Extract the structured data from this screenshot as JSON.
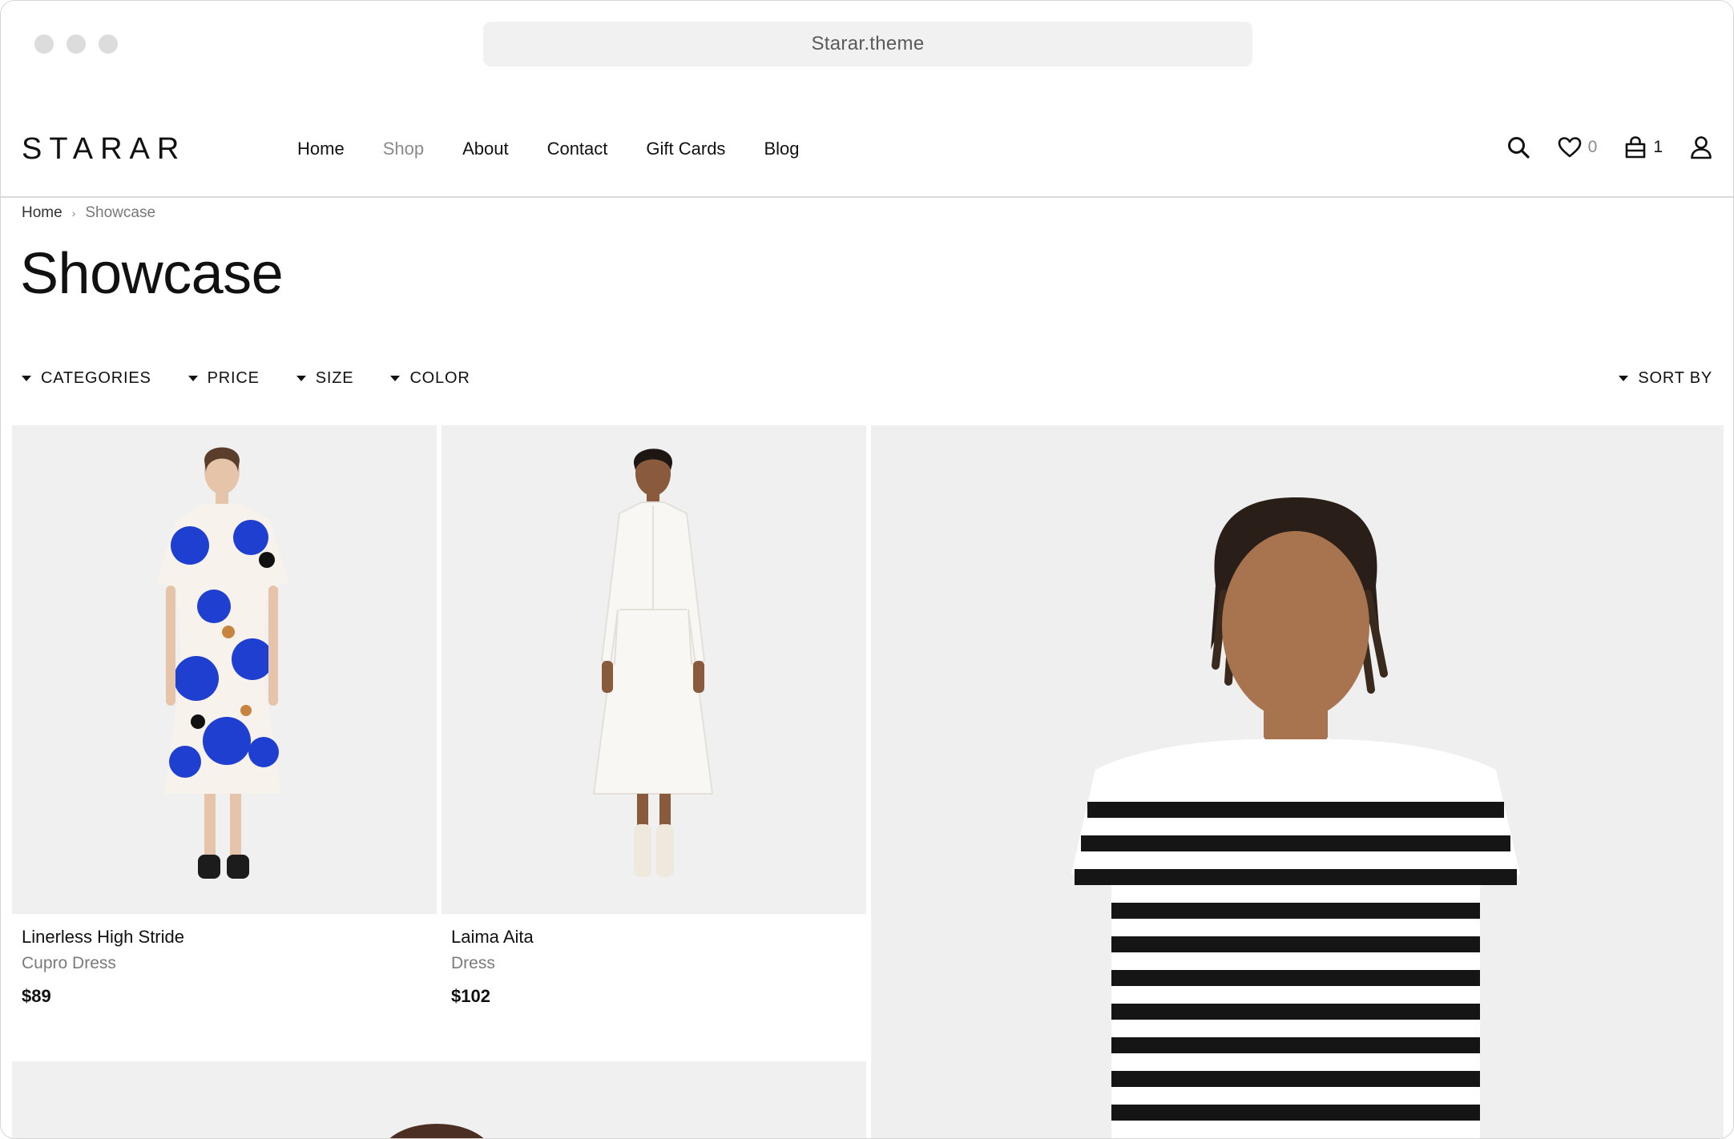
{
  "browser": {
    "url": "Starar.theme"
  },
  "header": {
    "logo": "STARAR",
    "nav": [
      {
        "label": "Home",
        "active": false
      },
      {
        "label": "Shop",
        "active": true
      },
      {
        "label": "About",
        "active": false
      },
      {
        "label": "Contact",
        "active": false
      },
      {
        "label": "Gift Cards",
        "active": false
      },
      {
        "label": "Blog",
        "active": false
      }
    ],
    "icons": [
      "search-icon",
      "heart-icon",
      "bag-icon",
      "user-icon"
    ],
    "wishlist_count": "0",
    "cart_count": "1"
  },
  "breadcrumb": {
    "home": "Home",
    "current": "Showcase"
  },
  "page_title": "Showcase",
  "filters": [
    "CATEGORIES",
    "PRICE",
    "SIZE",
    "COLOR"
  ],
  "sort_label": "SORT BY",
  "products": [
    {
      "name": "Linerless High Stride",
      "type": "Cupro Dress",
      "price": "$89"
    },
    {
      "name": "Laima Aita",
      "type": "Dress",
      "price": "$102"
    }
  ],
  "colors": {
    "accent_blue": "#1f3fd0",
    "image_bg": "#f0f0f0"
  }
}
